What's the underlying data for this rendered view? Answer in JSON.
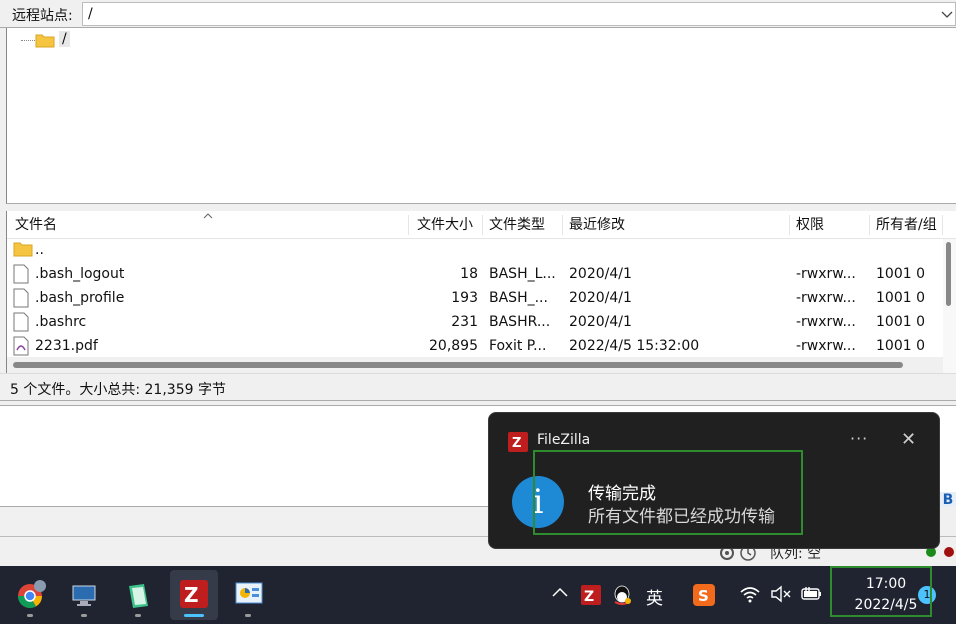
{
  "remote_site": {
    "label": "远程站点:",
    "path": "/"
  },
  "tree": {
    "root": "/"
  },
  "file_list": {
    "columns": [
      "文件名",
      "文件大小",
      "文件类型",
      "最近修改",
      "权限",
      "所有者/组"
    ],
    "rows": [
      {
        "name": "..",
        "size": "",
        "type": "",
        "modified": "",
        "perms": "",
        "owner": "",
        "icon": "folder-icon"
      },
      {
        "name": ".bash_logout",
        "size": "18",
        "type": "BASH_L...",
        "modified": "2020/4/1",
        "perms": "-rwxrw...",
        "owner": "1001 0",
        "icon": "file-icon"
      },
      {
        "name": ".bash_profile",
        "size": "193",
        "type": "BASH_...",
        "modified": "2020/4/1",
        "perms": "-rwxrw...",
        "owner": "1001 0",
        "icon": "file-icon"
      },
      {
        "name": ".bashrc",
        "size": "231",
        "type": "BASHR...",
        "modified": "2020/4/1",
        "perms": "-rwxrw...",
        "owner": "1001 0",
        "icon": "file-icon"
      },
      {
        "name": "2231.pdf",
        "size": "20,895",
        "type": "Foxit P...",
        "modified": "2022/4/5 15:32:00",
        "perms": "-rwxrw...",
        "owner": "1001 0",
        "icon": "pdf-file-icon"
      }
    ]
  },
  "status_bar": {
    "text": "5 个文件。大小总共: 21,359 字节"
  },
  "queue": {
    "label": "队列: 空"
  },
  "side_badge": "B",
  "toast": {
    "app": "FileZilla",
    "more": "···",
    "close": "✕",
    "info_glyph": "i",
    "title": "传输完成",
    "body": "所有文件都已经成功传输"
  },
  "taskbar": {
    "apps": [
      "chrome-icon",
      "remote-desktop-icon",
      "notepad-icon",
      "filezilla-icon",
      "control-panel-icon"
    ],
    "tray": {
      "chevron": "^",
      "ime": "英"
    },
    "clock": {
      "time": "17:00",
      "date": "2022/4/5"
    },
    "notification_count": "1"
  },
  "colors": {
    "toast_bg": "#202020",
    "info_blue": "#1e8ad6",
    "filezilla_red": "#bf1e1e",
    "highlight_green": "#2e8b2e",
    "taskbar_bg": "#1f2430"
  }
}
